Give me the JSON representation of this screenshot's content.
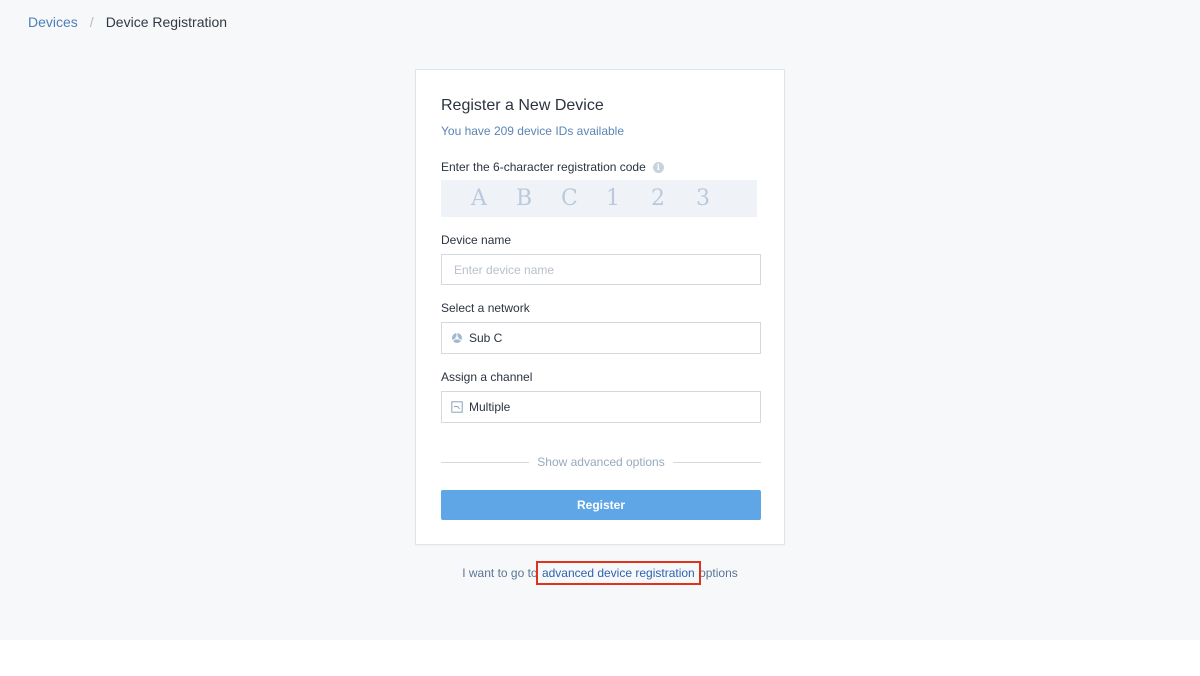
{
  "breadcrumb": {
    "parent": "Devices",
    "separator": "/",
    "current": "Device Registration"
  },
  "card": {
    "title": "Register a New Device",
    "subtitle": "You have 209 device IDs available",
    "code": {
      "label": "Enter the 6-character registration code",
      "info_icon": "info-icon",
      "placeholder_chars": [
        "A",
        "B",
        "C",
        "1",
        "2",
        "3"
      ]
    },
    "device_name": {
      "label": "Device name",
      "value": "",
      "placeholder": "Enter device name"
    },
    "network": {
      "label": "Select a network",
      "icon": "network-icon",
      "value": "Sub C"
    },
    "channel": {
      "label": "Assign a channel",
      "icon": "channel-icon",
      "value": "Multiple"
    },
    "advanced_toggle": "Show advanced options",
    "register_label": "Register"
  },
  "footer": {
    "prefix": "I want to go to",
    "link": "advanced device registration",
    "suffix": "options"
  },
  "colors": {
    "accent": "#5fa6e6",
    "link": "#2d64b0",
    "highlight": "#e0331e"
  }
}
